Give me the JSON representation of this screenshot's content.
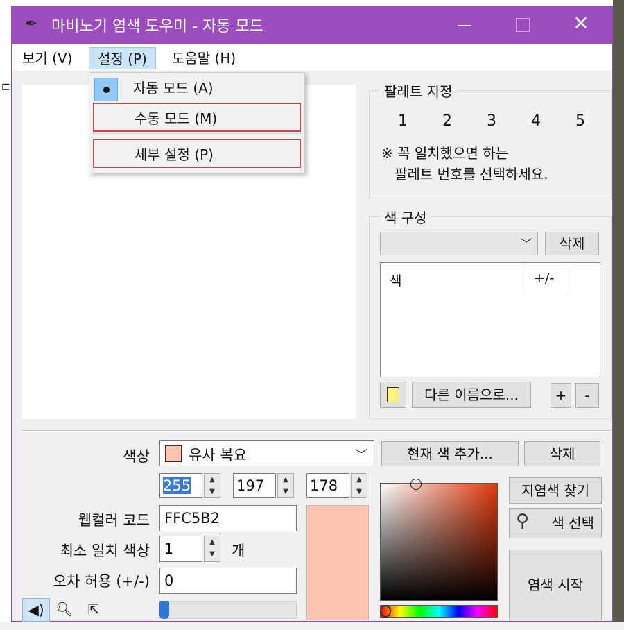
{
  "window": {
    "title": "마비노기 염색 도우미 - 자동 모드",
    "title_icon": "brush-icon",
    "close_glyph": "✕"
  },
  "menu": {
    "view": "보기 (V)",
    "settings": "설정 (P)",
    "help": "도움말 (H)"
  },
  "dropdown": {
    "auto_mode": "자동 모드 (A)",
    "manual_mode": "수동 모드 (M)",
    "detail_settings": "세부 설정 (P)"
  },
  "palette": {
    "label": "팔레트 지정",
    "numbers": [
      "1",
      "2",
      "3",
      "4",
      "5"
    ],
    "note": "※ 꼭 일치했으면 하는\n   팔레트 번호를 선택하세요."
  },
  "color_set": {
    "label": "색 구성",
    "delete": "삭제",
    "columns": [
      "색",
      "+/-"
    ],
    "save_as": "다른 이름으로...",
    "plus": "+",
    "minus": "-"
  },
  "controls": {
    "color_label": "색상",
    "hue_value": "유사 복요",
    "add_current": "현재 색 추가...",
    "delete_color": "삭제",
    "r": "255",
    "g": "197",
    "b": "178",
    "web_label": "웹컬러 코드",
    "web_value": "FFC5B2",
    "min_label": "최소 일치 색상",
    "min_value": "1",
    "count_unit": "개",
    "tol_label": "오차 허용 (+/-)",
    "tol_value": "0",
    "find_dye": "지염색 찾기",
    "pick_color": "색 선택",
    "start_dye": "염색 시작",
    "tolerance_slider_fraction": 0.0
  },
  "colors": {
    "title_bar": "#9b4dbd",
    "preview": "#FFC5B2",
    "picker_hue": "#e03a0c"
  },
  "tools": {
    "tool1_icon": "speaker-icon",
    "tool2_icon": "magnifier-icon",
    "tool3_icon": "pointer-icon"
  },
  "bg": {
    "left_glyph": "ㄷ"
  }
}
